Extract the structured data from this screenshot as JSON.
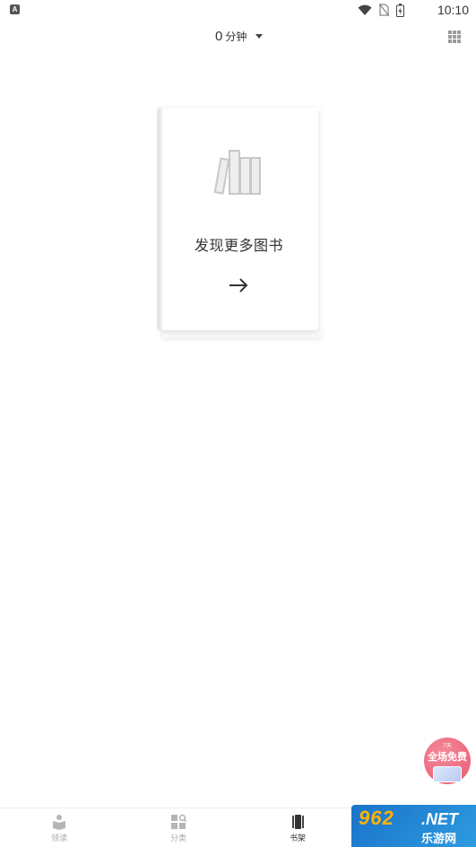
{
  "status_bar": {
    "badge": "A",
    "time": "10:10"
  },
  "top_bar": {
    "reading_minutes": "0",
    "minutes_unit": "分钟"
  },
  "discover_card": {
    "label": "发现更多图书",
    "arrow": "→"
  },
  "promo": {
    "small_text": "7天",
    "text": "全场免费"
  },
  "bottom_nav": {
    "items": [
      {
        "label": "领读",
        "icon": "book-reader-icon",
        "active": false
      },
      {
        "label": "分类",
        "icon": "category-grid-icon",
        "active": false
      },
      {
        "label": "书架",
        "icon": "bookshelf-icon",
        "active": true
      }
    ]
  },
  "watermark": {
    "top": "962",
    "net": ".NET",
    "bottom": "乐游网"
  },
  "colors": {
    "promo": "#e85a70",
    "watermark_blue": "#1a73c9",
    "watermark_orange": "#ffb400"
  }
}
